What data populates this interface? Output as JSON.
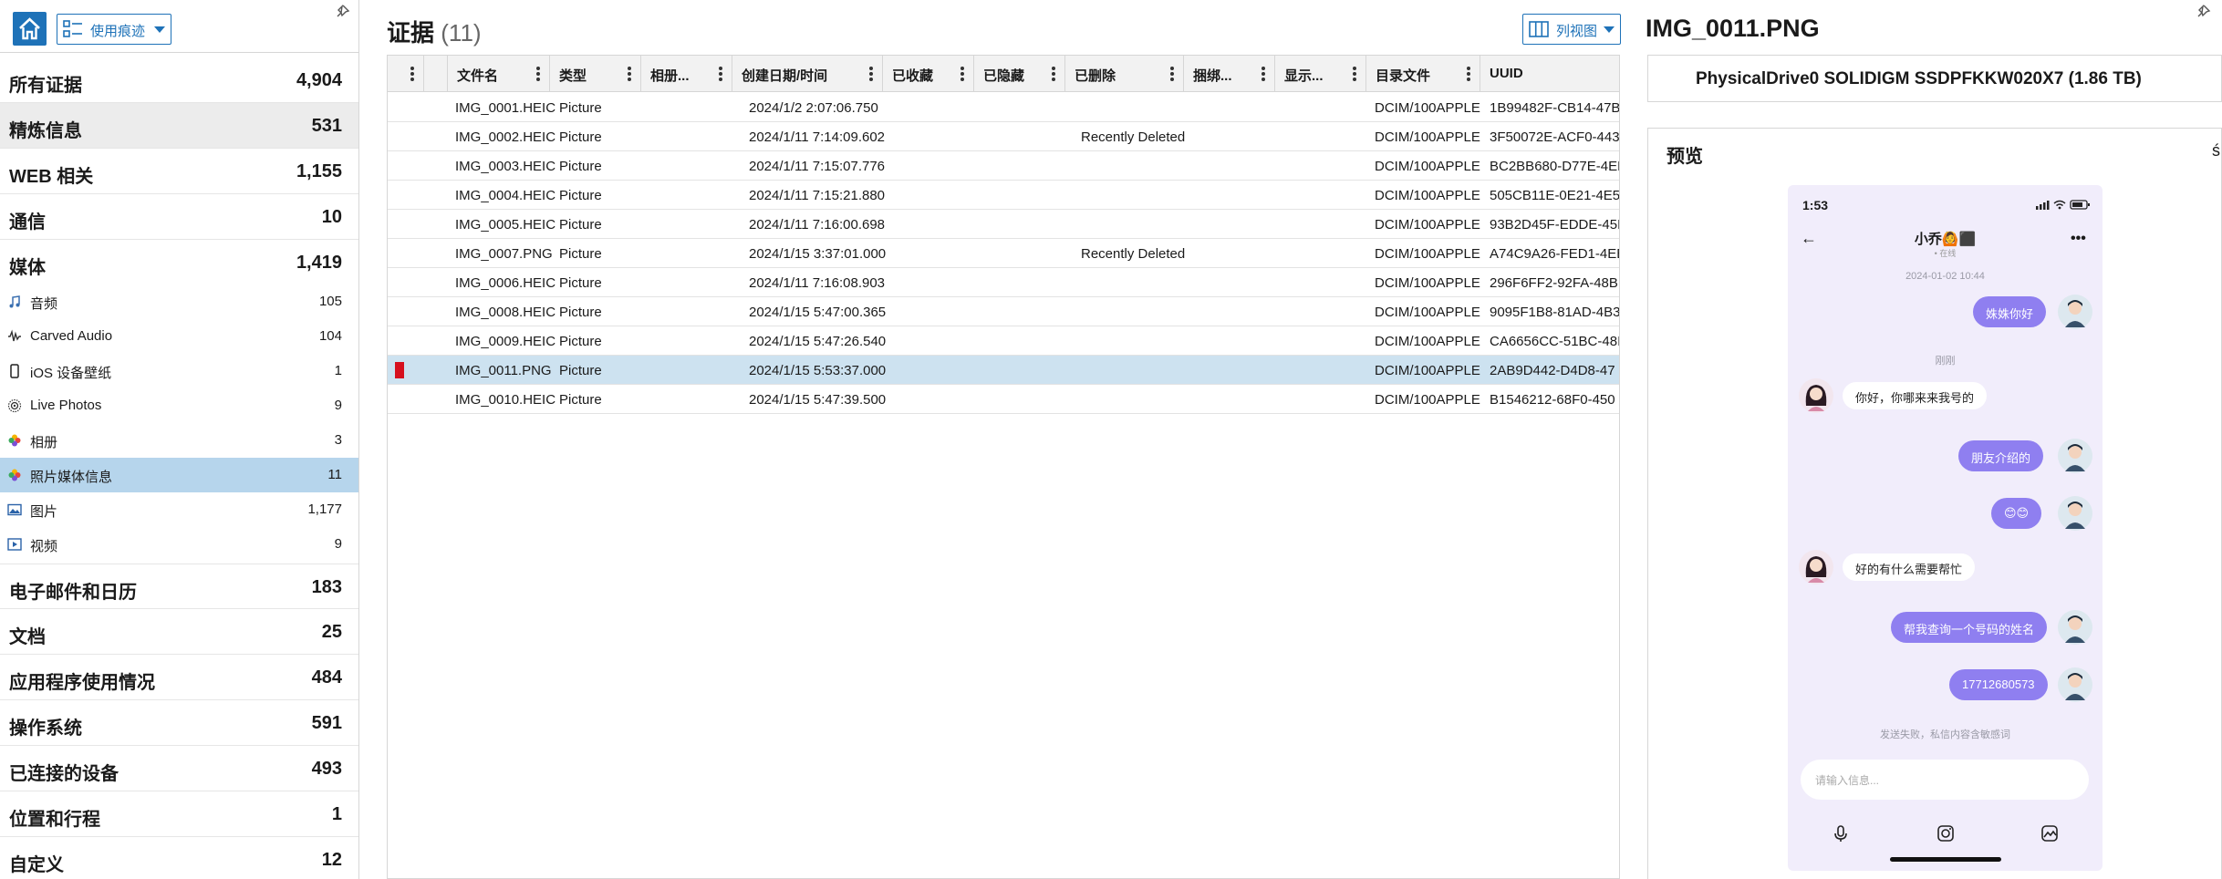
{
  "sidebar": {
    "usage_label": "使用痕迹",
    "categories_top": [
      {
        "name": "所有证据",
        "count": "4,904"
      },
      {
        "name": "精炼信息",
        "count": "531"
      },
      {
        "name": "WEB 相关",
        "count": "1,155"
      },
      {
        "name": "通信",
        "count": "10"
      },
      {
        "name": "媒体",
        "count": "1,419"
      }
    ],
    "media_items": [
      {
        "name": "音频",
        "count": "105",
        "icon": "music-note-icon"
      },
      {
        "name": "Carved Audio",
        "count": "104",
        "icon": "audio-wave-icon"
      },
      {
        "name": "iOS 设备壁纸",
        "count": "1",
        "icon": "phone-icon"
      },
      {
        "name": "Live Photos",
        "count": "9",
        "icon": "live-photo-icon"
      },
      {
        "name": "相册",
        "count": "3",
        "icon": "photos-app-icon"
      },
      {
        "name": "照片媒体信息",
        "count": "11",
        "icon": "photos-app-icon"
      },
      {
        "name": "图片",
        "count": "1,177",
        "icon": "image-icon"
      },
      {
        "name": "视频",
        "count": "9",
        "icon": "video-icon"
      }
    ],
    "categories_bottom": [
      {
        "name": "电子邮件和日历",
        "count": "183"
      },
      {
        "name": "文档",
        "count": "25"
      },
      {
        "name": "应用程序使用情况",
        "count": "484"
      },
      {
        "name": "操作系统",
        "count": "591"
      },
      {
        "name": "已连接的设备",
        "count": "493"
      },
      {
        "name": "位置和行程",
        "count": "1"
      },
      {
        "name": "自定义",
        "count": "12"
      }
    ]
  },
  "evidence": {
    "title": "证据",
    "count": "(11)",
    "column_view_label": "列视图",
    "columns": [
      "文件名",
      "类型",
      "相册...",
      "创建日期/时间",
      "已收藏",
      "已隐藏",
      "已删除",
      "捆绑...",
      "显示...",
      "目录文件",
      "UUID"
    ],
    "rows": [
      {
        "file": "IMG_0001.HEIC",
        "type": "Picture",
        "created": "2024/1/2 2:07:06.750",
        "deleted": "",
        "dir": "DCIM/100APPLE",
        "uuid": "1B99482F-CB14-47B",
        "flag": false
      },
      {
        "file": "IMG_0002.HEIC",
        "type": "Picture",
        "created": "2024/1/11 7:14:09.602",
        "deleted": "Recently Deleted",
        "dir": "DCIM/100APPLE",
        "uuid": "3F50072E-ACF0-443",
        "flag": false
      },
      {
        "file": "IMG_0003.HEIC",
        "type": "Picture",
        "created": "2024/1/11 7:15:07.776",
        "deleted": "",
        "dir": "DCIM/100APPLE",
        "uuid": "BC2BB680-D77E-4ED",
        "flag": false
      },
      {
        "file": "IMG_0004.HEIC",
        "type": "Picture",
        "created": "2024/1/11 7:15:21.880",
        "deleted": "",
        "dir": "DCIM/100APPLE",
        "uuid": "505CB11E-0E21-4E5",
        "flag": false
      },
      {
        "file": "IMG_0005.HEIC",
        "type": "Picture",
        "created": "2024/1/11 7:16:00.698",
        "deleted": "",
        "dir": "DCIM/100APPLE",
        "uuid": "93B2D45F-EDDE-45I",
        "flag": false
      },
      {
        "file": "IMG_0007.PNG",
        "type": "Picture",
        "created": "2024/1/15 3:37:01.000",
        "deleted": "Recently Deleted",
        "dir": "DCIM/100APPLE",
        "uuid": "A74C9A26-FED1-4EE",
        "flag": false
      },
      {
        "file": "IMG_0006.HEIC",
        "type": "Picture",
        "created": "2024/1/11 7:16:08.903",
        "deleted": "",
        "dir": "DCIM/100APPLE",
        "uuid": "296F6FF2-92FA-48B",
        "flag": false
      },
      {
        "file": "IMG_0008.HEIC",
        "type": "Picture",
        "created": "2024/1/15 5:47:00.365",
        "deleted": "",
        "dir": "DCIM/100APPLE",
        "uuid": "9095F1B8-81AD-4B3",
        "flag": false
      },
      {
        "file": "IMG_0009.HEIC",
        "type": "Picture",
        "created": "2024/1/15 5:47:26.540",
        "deleted": "",
        "dir": "DCIM/100APPLE",
        "uuid": "CA6656CC-51BC-48I",
        "flag": false
      },
      {
        "file": "IMG_0011.PNG",
        "type": "Picture",
        "created": "2024/1/15 5:53:37.000",
        "deleted": "",
        "dir": "DCIM/100APPLE",
        "uuid": "2AB9D442-D4D8-47",
        "flag": true
      },
      {
        "file": "IMG_0010.HEIC",
        "type": "Picture",
        "created": "2024/1/15 5:47:39.500",
        "deleted": "",
        "dir": "DCIM/100APPLE",
        "uuid": "B1546212-68F0-450",
        "flag": false
      }
    ]
  },
  "details": {
    "title": "IMG_0011.PNG",
    "drive": "PhysicalDrive0 SOLIDIGM SSDPFKKW020X7 (1.86 TB)",
    "preview_label": "预览",
    "preview_more": "ś"
  },
  "phone": {
    "time": "1:53",
    "back": "←",
    "contact": "小乔🙆⬛",
    "contact_sub": "• 在线",
    "menu": "•••",
    "stamp1": "2024-01-02 10:44",
    "stamp2": "刚刚",
    "msg1": "姝姝你好",
    "msg2": "你好，你哪来来我号的",
    "msg3": "朋友介绍的",
    "msg4": "😊😊",
    "msg5": "好的有什么需要帮忙",
    "msg6": "帮我查询一个号码的姓名",
    "msg7": "17712680573",
    "fail_note": "发送失败，私信内容含敏感词",
    "input_placeholder": "请输入信息..."
  },
  "colors": {
    "accent": "#1e72b8",
    "selection": "#b6d5ec",
    "row_selection": "#cde2f0",
    "flag": "#d6101e",
    "bubble": "#8f7ff0"
  }
}
